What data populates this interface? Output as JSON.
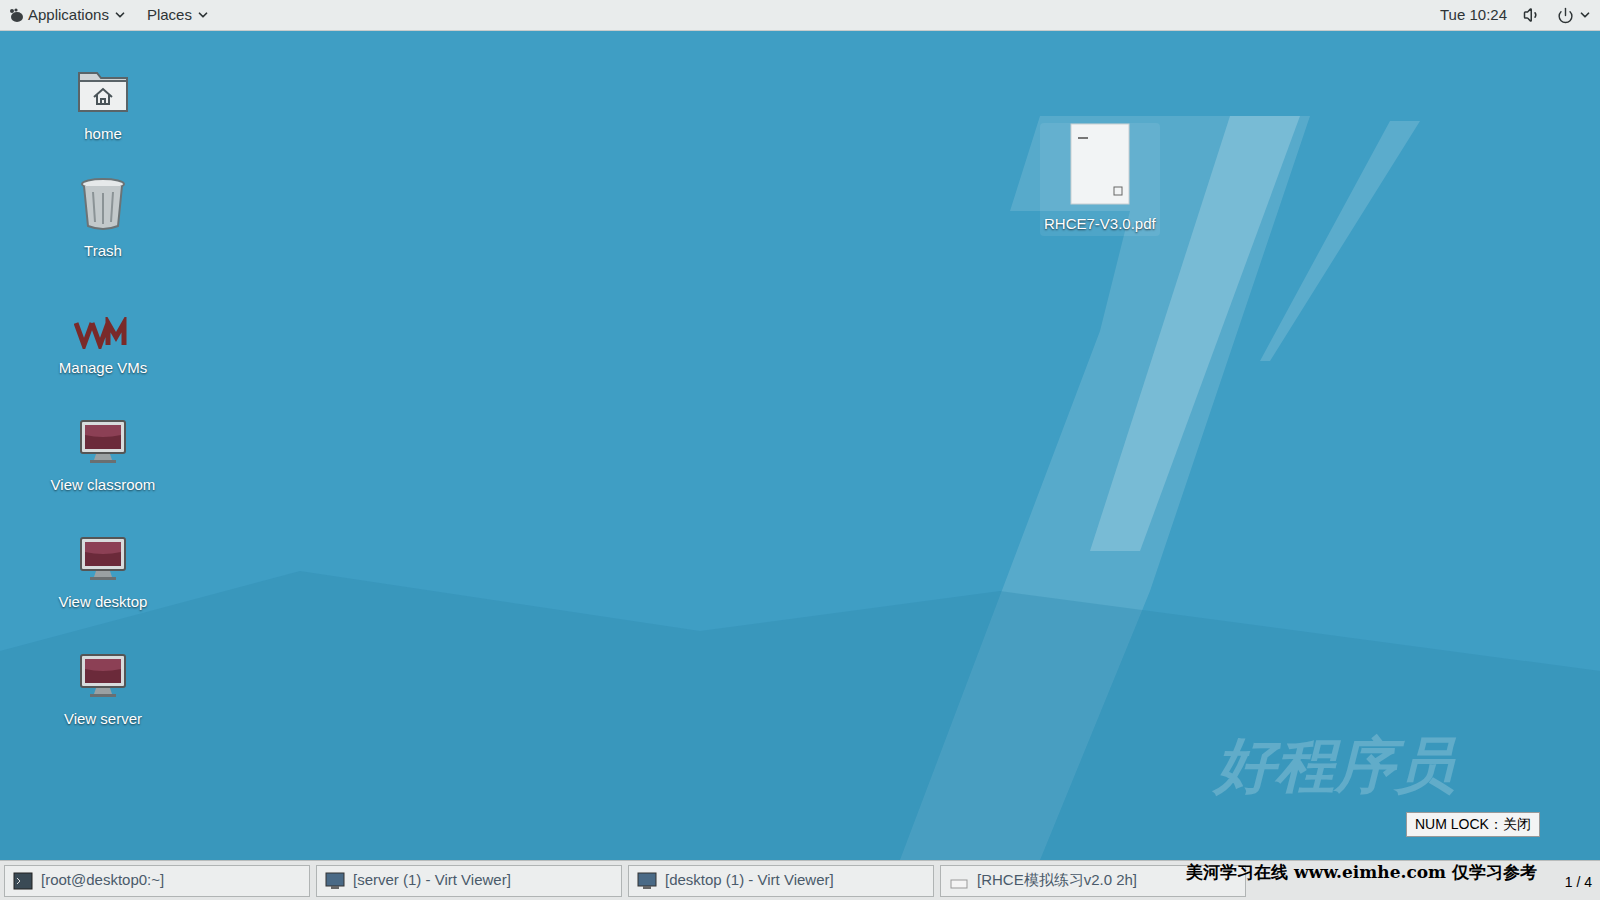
{
  "top_bar": {
    "menus": [
      {
        "label": "Applications"
      },
      {
        "label": "Places"
      }
    ],
    "clock": "Tue 10:24"
  },
  "desktop_icons": [
    {
      "label": "home",
      "kind": "home"
    },
    {
      "label": "Trash",
      "kind": "trash"
    },
    {
      "label": "Manage VMs",
      "kind": "vms"
    },
    {
      "label": "View classroom",
      "kind": "monitor"
    },
    {
      "label": "View desktop",
      "kind": "monitor"
    },
    {
      "label": "View server",
      "kind": "monitor"
    }
  ],
  "file": {
    "label": "RHCE7-V3.0.pdf",
    "selected": true
  },
  "numlock": "NUM LOCK：关闭",
  "watermark_logo": "好程序员",
  "taskbar": {
    "windows": [
      {
        "label": "[root@desktop0:~]",
        "kind": "terminal"
      },
      {
        "label": "[server (1) - Virt Viewer]",
        "kind": "viewer"
      },
      {
        "label": "[desktop (1) - Virt Viewer]",
        "kind": "viewer"
      },
      {
        "label": "[RHCE模拟练习v2.0 2h]",
        "kind": "document"
      }
    ]
  },
  "watermark": "美河学习在线 www.eimhe.com 仅学习参考",
  "page": "1 / 4"
}
